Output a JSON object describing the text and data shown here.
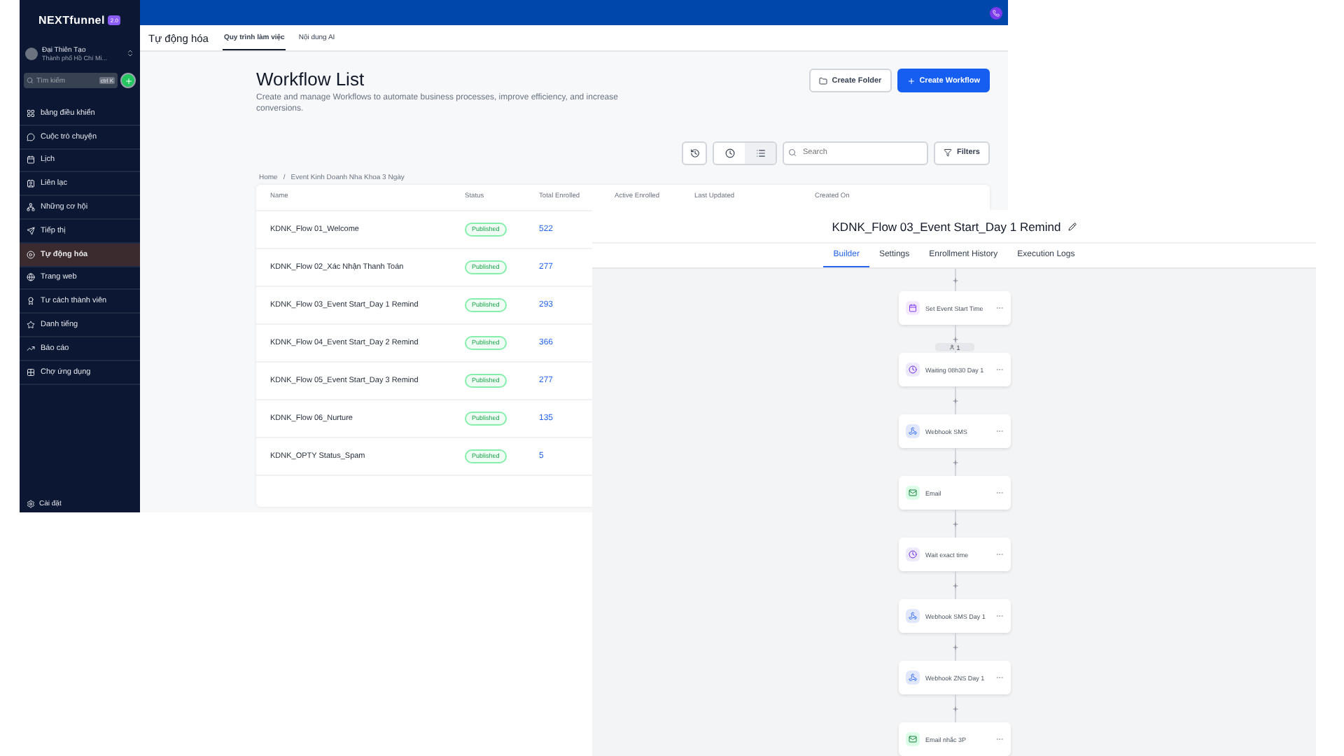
{
  "sidebar": {
    "logo": "NEXTfunnel",
    "logo_badge": "2.0",
    "account": {
      "name": "Đại Thiên Tạo",
      "location": "Thành phố Hồ Chí Mi..."
    },
    "search": {
      "placeholder": "Tìm kiếm",
      "shortcut": "ctrl K"
    },
    "items": [
      {
        "label": "bảng điều khiển",
        "selected": false
      },
      {
        "label": "Cuộc trò chuyện",
        "selected": false
      },
      {
        "label": "Lịch",
        "selected": false
      },
      {
        "label": "Liên lạc",
        "selected": false
      },
      {
        "label": "Những cơ hội",
        "selected": false
      },
      {
        "label": "Tiếp thị",
        "selected": false
      },
      {
        "label": "Tự động hóa",
        "selected": true
      },
      {
        "label": "Trang web",
        "selected": false
      },
      {
        "label": "Tư cách thành viên",
        "selected": false
      },
      {
        "label": "Danh tiếng",
        "selected": false
      },
      {
        "label": "Báo cáo",
        "selected": false
      },
      {
        "label": "Chợ ứng dụng",
        "selected": false
      }
    ],
    "footer": "Cài đặt"
  },
  "header": {
    "title": "Tự động hóa",
    "tabs": [
      {
        "label": "Quy trình làm việc",
        "selected": true
      },
      {
        "label": "Nội dung AI",
        "selected": false
      }
    ]
  },
  "page": {
    "title": "Workflow List",
    "subtitle": "Create and manage Workflows to automate business processes, improve efficiency, and increase conversions.",
    "buttons": [
      {
        "kind": "secondary",
        "label": "Create Folder"
      },
      {
        "kind": "primary",
        "label": "Create Workflow"
      }
    ],
    "view_buttons": [
      {
        "selected": false
      },
      {
        "selected": true
      }
    ],
    "search": {
      "placeholder": "Search"
    },
    "filters_label": "Filters",
    "breadcrumb": {
      "items": [
        "Home",
        "Event Kinh Doanh Nha Khoa 3 Ngày"
      ],
      "separator": "/"
    }
  },
  "table": {
    "columns": [
      "Name",
      "Status",
      "Total Enrolled",
      "Active Enrolled",
      "Last Updated",
      "Created On"
    ],
    "rows": [
      {
        "name": "KDNK_Flow 01_Welcome",
        "status": "Published",
        "total_enrolled": "522"
      },
      {
        "name": "KDNK_Flow 02_Xác Nhận Thanh Toán",
        "status": "Published",
        "total_enrolled": "277"
      },
      {
        "name": "KDNK_Flow 03_Event Start_Day 1 Remind",
        "status": "Published",
        "total_enrolled": "293"
      },
      {
        "name": "KDNK_Flow 04_Event Start_Day 2 Remind",
        "status": "Published",
        "total_enrolled": "366"
      },
      {
        "name": "KDNK_Flow 05_Event Start_Day 3 Remind",
        "status": "Published",
        "total_enrolled": "277"
      },
      {
        "name": "KDNK_Flow 06_Nurture",
        "status": "Published",
        "total_enrolled": "135"
      },
      {
        "name": "KDNK_OPTY Status_Spam",
        "status": "Published",
        "total_enrolled": "5"
      }
    ]
  },
  "builder": {
    "title": "KDNK_Flow 03_Event Start_Day 1 Remind",
    "tabs": [
      {
        "label": "Builder",
        "selected": true
      },
      {
        "label": "Settings",
        "selected": false
      },
      {
        "label": "Enrollment History",
        "selected": false
      },
      {
        "label": "Execution Logs",
        "selected": false
      }
    ],
    "enrolled_badge": "1",
    "nodes": [
      {
        "kind": "calendar",
        "label": "Set Event Start Time"
      },
      {
        "kind": "wait",
        "label": "Waiting 08h30 Day 1"
      },
      {
        "kind": "webhook",
        "label": "Webhook SMS"
      },
      {
        "kind": "email",
        "label": "Email"
      },
      {
        "kind": "wait",
        "label": "Wait exact time"
      },
      {
        "kind": "webhook",
        "label": "Webhook SMS Day 1"
      },
      {
        "kind": "webhook",
        "label": "Webhook ZNS Day 1"
      },
      {
        "kind": "email",
        "label": "Email nhắc 3P"
      }
    ]
  }
}
